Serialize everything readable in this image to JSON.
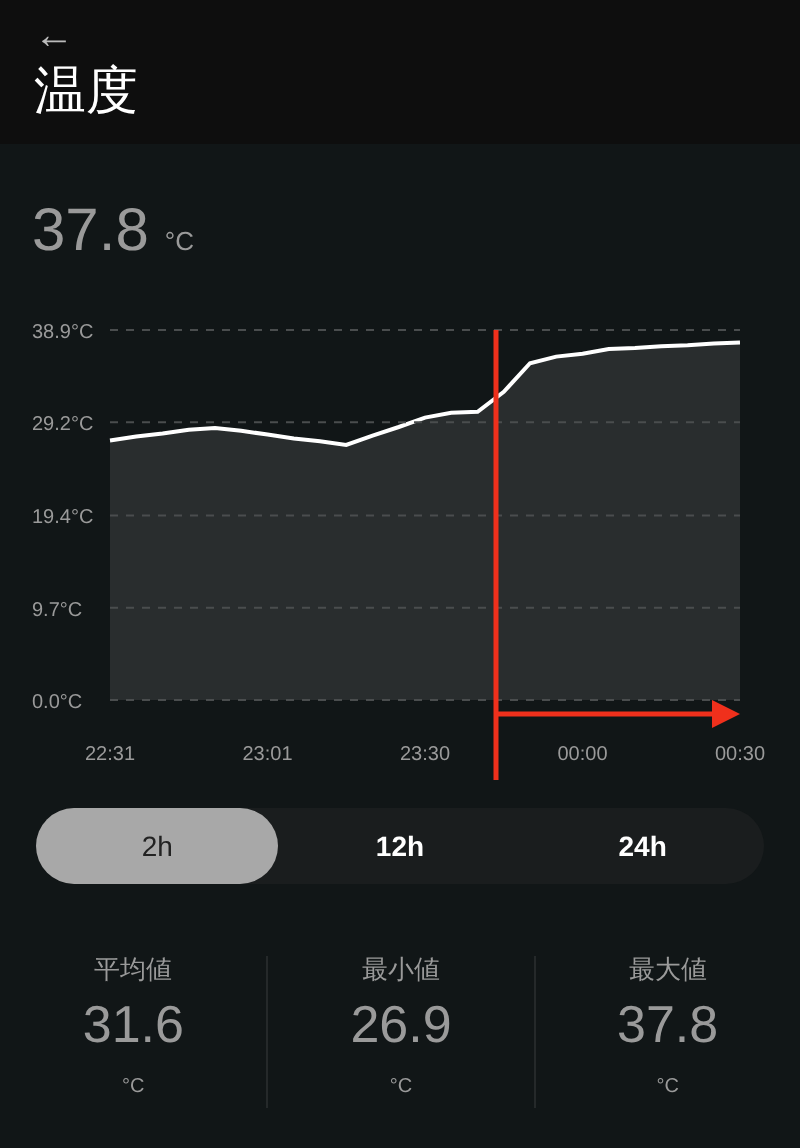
{
  "header": {
    "back": "←",
    "title": "温度"
  },
  "current": {
    "value": "37.8",
    "unit": "°C"
  },
  "chart": {
    "chart_data": {
      "type": "line",
      "categories": [
        "22:31",
        null,
        null,
        null,
        null,
        null,
        "23:01",
        null,
        null,
        null,
        null,
        null,
        "23:30",
        null,
        null,
        null,
        null,
        null,
        "00:00",
        null,
        null,
        null,
        null,
        null,
        "00:30"
      ],
      "series": [
        {
          "color": "#ffffff",
          "values": [
            27.3,
            27.7,
            28.0,
            28.4,
            28.6,
            28.3,
            27.9,
            27.5,
            27.2,
            26.8,
            27.8,
            28.7,
            29.7,
            30.2,
            30.3,
            32.4,
            35.4,
            36.1,
            36.4,
            36.9,
            37.0,
            37.2,
            37.3,
            37.5,
            37.6
          ]
        }
      ],
      "ylim": [
        0,
        38.9
      ],
      "grid": true,
      "yticks": [
        {
          "value": 0,
          "label": "0.0°C"
        },
        {
          "value": 9.7,
          "label": "9.7°C"
        },
        {
          "value": 19.4,
          "label": "19.4°C"
        },
        {
          "value": 29.2,
          "label": "29.2°C"
        },
        {
          "value": 38.9,
          "label": "38.9°C"
        }
      ]
    }
  },
  "ranges": [
    {
      "label": "2h",
      "selected": true
    },
    {
      "label": "12h",
      "selected": false
    },
    {
      "label": "24h",
      "selected": false
    }
  ],
  "stats": [
    {
      "label": "平均値",
      "value": "31.6",
      "unit": "°C"
    },
    {
      "label": "最小値",
      "value": "26.9",
      "unit": "°C"
    },
    {
      "label": "最大値",
      "value": "37.8",
      "unit": "°C"
    }
  ]
}
